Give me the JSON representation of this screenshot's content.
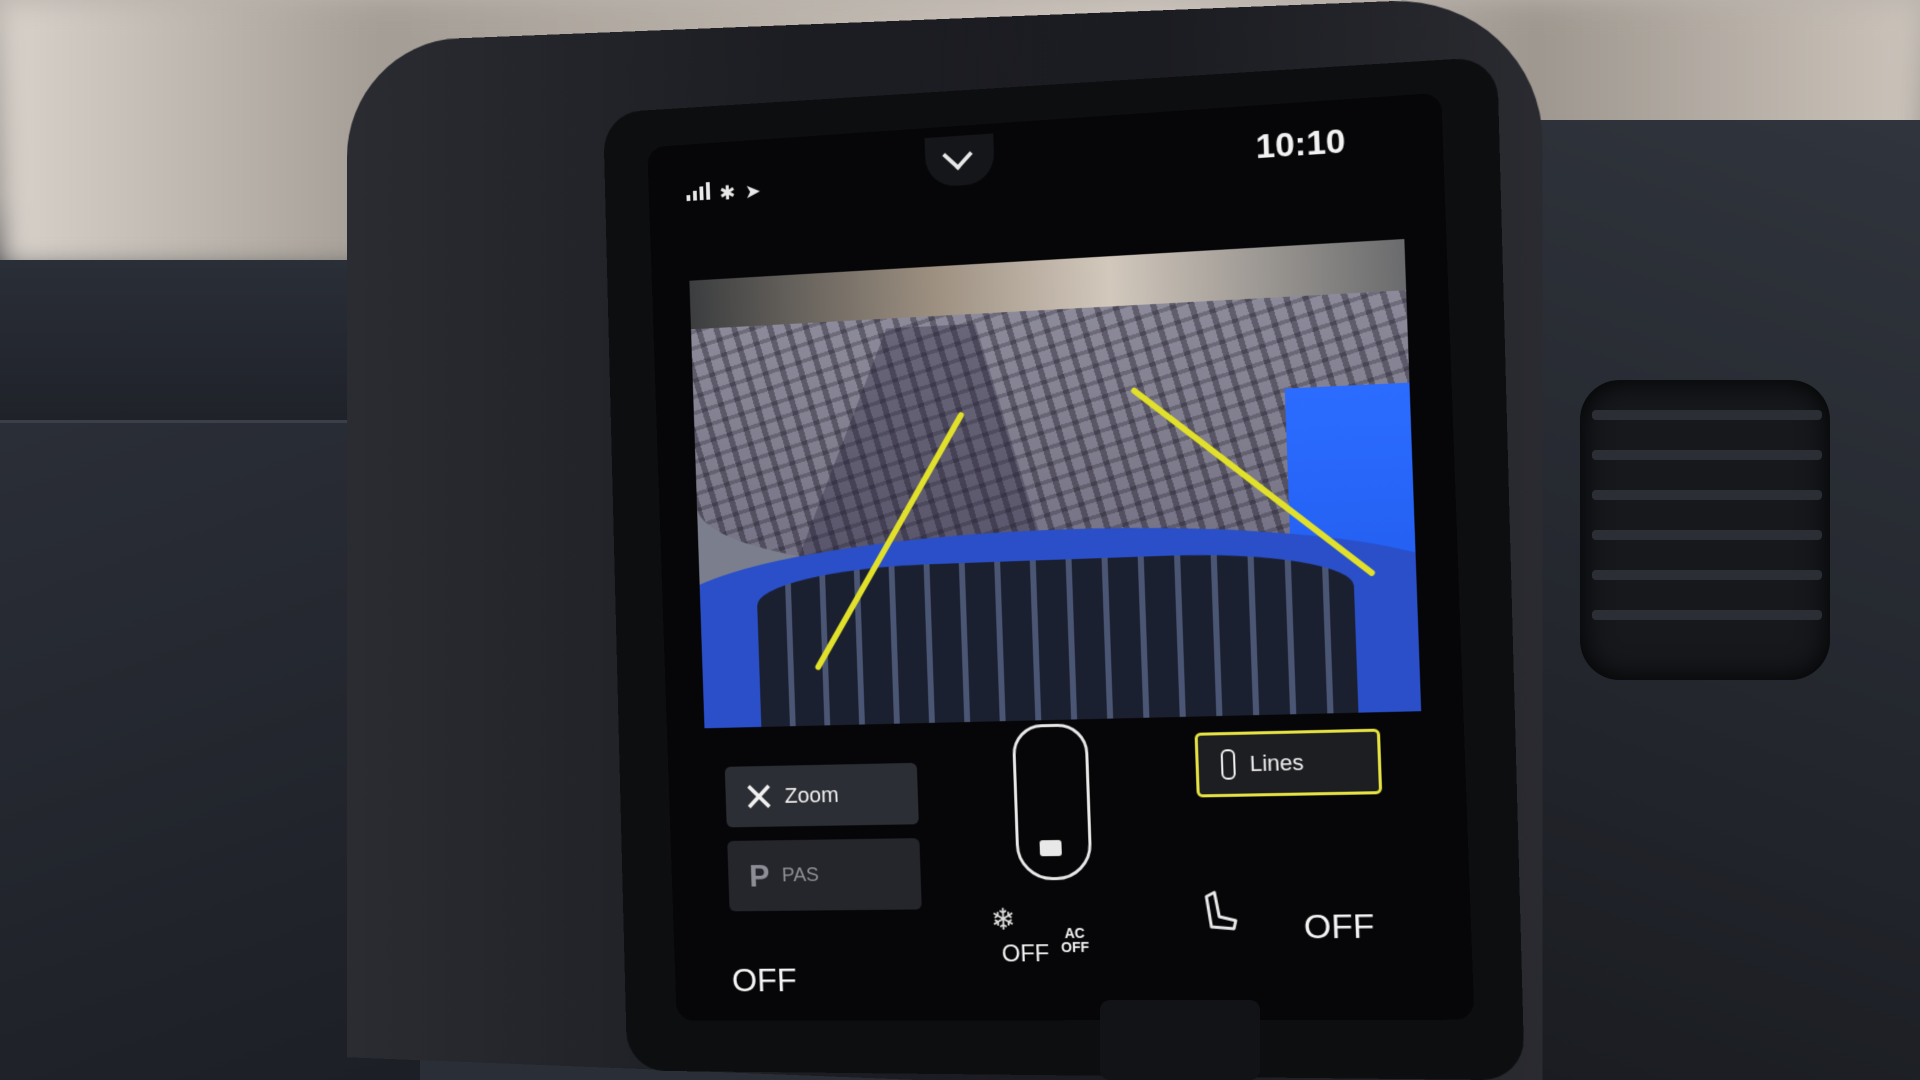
{
  "status_bar": {
    "icons": [
      "signal-icon",
      "bluetooth-icon",
      "location-arrow-icon"
    ],
    "time": "10:10",
    "pull_down": "chevron-down-icon"
  },
  "camera_view": {
    "icons": [
      "rear-camera-feed"
    ],
    "guide_color": "#e1e02b"
  },
  "controls": {
    "zoom_label": "Zoom",
    "pas_glyph": "P",
    "pas_label": "PAS",
    "lines_label": "Lines",
    "lines_active": true,
    "active_border_color": "#e6e243"
  },
  "climate": {
    "left_temp": "OFF",
    "fan": "OFF",
    "ac_line1": "AC",
    "ac_line2": "OFF",
    "right_seat": "OFF"
  }
}
